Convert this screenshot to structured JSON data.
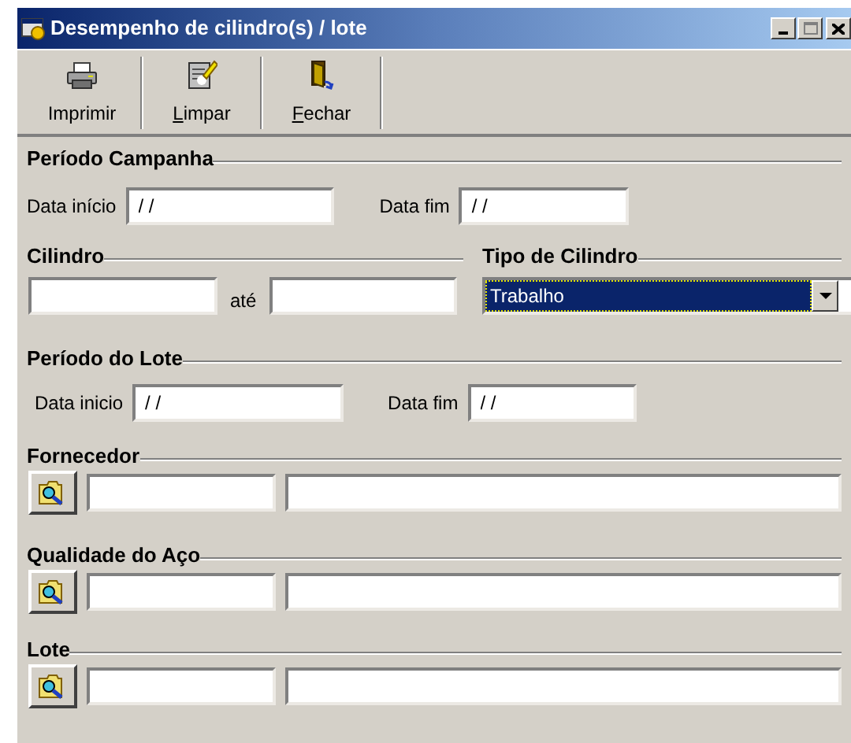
{
  "window": {
    "title": "Desempenho de cilindro(s) / lote"
  },
  "toolbar": [
    {
      "label": "Imprimir",
      "kind": "printer",
      "mnemonic": false
    },
    {
      "label": "Limpar",
      "kind": "clear",
      "mnemonic": true
    },
    {
      "label": "Fechar",
      "kind": "close",
      "mnemonic": true
    }
  ],
  "periodo_campanha": {
    "title": "Período Campanha",
    "start_label": "Data início",
    "start_value": "/ /",
    "end_label": "Data fim",
    "end_value": "/ /"
  },
  "cilindro": {
    "title": "Cilindro",
    "between_label": "até"
  },
  "tipo_cilindro": {
    "title": "Tipo de Cilindro",
    "value": "Trabalho",
    "focused": true
  },
  "periodo_lote": {
    "title": "Período do Lote",
    "start_label": "Data inicio",
    "start_value": "/ /",
    "end_label": "Data fim",
    "end_value": "/ /"
  },
  "lookups": [
    {
      "title": "Fornecedor"
    },
    {
      "title": "Qualidade do Aço"
    },
    {
      "title": "Lote"
    }
  ]
}
